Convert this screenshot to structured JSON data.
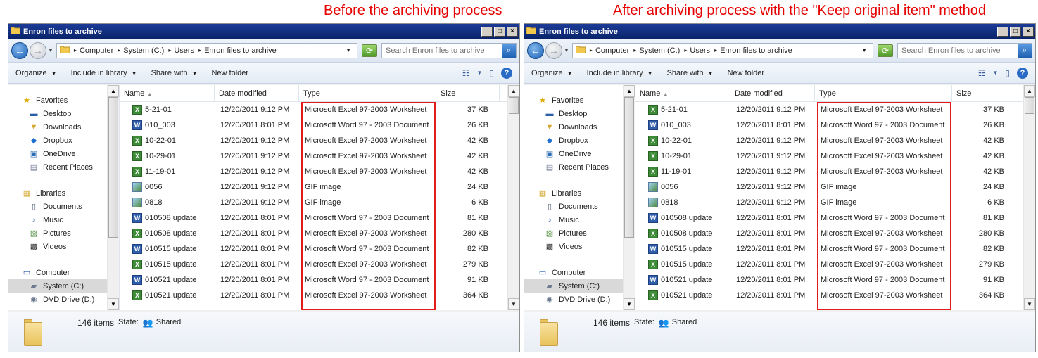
{
  "captions": {
    "left": "Before the archiving process",
    "right": "After archiving process with the \"Keep original item\" method"
  },
  "window": {
    "title": "Enron files to archive",
    "breadcrumb": [
      "Computer",
      "System (C:)",
      "Users",
      "Enron files to archive"
    ],
    "search_placeholder": "Search Enron files to archive",
    "toolbar": {
      "organize": "Organize",
      "include_in_library": "Include in library",
      "share_with": "Share with",
      "new_folder": "New folder"
    },
    "nav": {
      "favorites": "Favorites",
      "favorites_items": [
        "Desktop",
        "Downloads",
        "Dropbox",
        "OneDrive",
        "Recent Places"
      ],
      "libraries": "Libraries",
      "libraries_items": [
        "Documents",
        "Music",
        "Pictures",
        "Videos"
      ],
      "computer": "Computer",
      "computer_items": [
        "System (C:)",
        "DVD Drive (D:)"
      ]
    },
    "columns": {
      "name": "Name",
      "date": "Date modified",
      "type": "Type",
      "size": "Size"
    },
    "files": [
      {
        "name": "5-21-01",
        "icon": "xls",
        "date": "12/20/2011 9:12 PM",
        "type": "Microsoft Excel 97-2003 Worksheet",
        "size": "37 KB"
      },
      {
        "name": "010_003",
        "icon": "doc",
        "date": "12/20/2011 8:01 PM",
        "type": "Microsoft Word 97 - 2003 Document",
        "size": "26 KB"
      },
      {
        "name": "10-22-01",
        "icon": "xls",
        "date": "12/20/2011 9:12 PM",
        "type": "Microsoft Excel 97-2003 Worksheet",
        "size": "42 KB"
      },
      {
        "name": "10-29-01",
        "icon": "xls",
        "date": "12/20/2011 9:12 PM",
        "type": "Microsoft Excel 97-2003 Worksheet",
        "size": "42 KB"
      },
      {
        "name": "11-19-01",
        "icon": "xls",
        "date": "12/20/2011 9:12 PM",
        "type": "Microsoft Excel 97-2003 Worksheet",
        "size": "42 KB"
      },
      {
        "name": "0056",
        "icon": "gif",
        "date": "12/20/2011 9:12 PM",
        "type": "GIF image",
        "size": "24 KB"
      },
      {
        "name": "0818",
        "icon": "gif",
        "date": "12/20/2011 9:12 PM",
        "type": "GIF image",
        "size": "6 KB"
      },
      {
        "name": "010508 update",
        "icon": "doc",
        "date": "12/20/2011 8:01 PM",
        "type": "Microsoft Word 97 - 2003 Document",
        "size": "81 KB"
      },
      {
        "name": "010508 update",
        "icon": "xls",
        "date": "12/20/2011 8:01 PM",
        "type": "Microsoft Excel 97-2003 Worksheet",
        "size": "280 KB"
      },
      {
        "name": "010515 update",
        "icon": "doc",
        "date": "12/20/2011 8:01 PM",
        "type": "Microsoft Word 97 - 2003 Document",
        "size": "82 KB"
      },
      {
        "name": "010515 update",
        "icon": "xls",
        "date": "12/20/2011 8:01 PM",
        "type": "Microsoft Excel 97-2003 Worksheet",
        "size": "279 KB"
      },
      {
        "name": "010521 update",
        "icon": "doc",
        "date": "12/20/2011 8:01 PM",
        "type": "Microsoft Word 97 - 2003 Document",
        "size": "91 KB"
      },
      {
        "name": "010521 update",
        "icon": "xls",
        "date": "12/20/2011 8:01 PM",
        "type": "Microsoft Excel 97-2003 Worksheet",
        "size": "364 KB"
      }
    ],
    "status": {
      "count": "146 items",
      "state_label": "State:",
      "state_value": "Shared"
    }
  },
  "colors": {
    "caption": "#e60000",
    "highlight_box": "#e21b1b",
    "titlebar": "#0a246a"
  }
}
